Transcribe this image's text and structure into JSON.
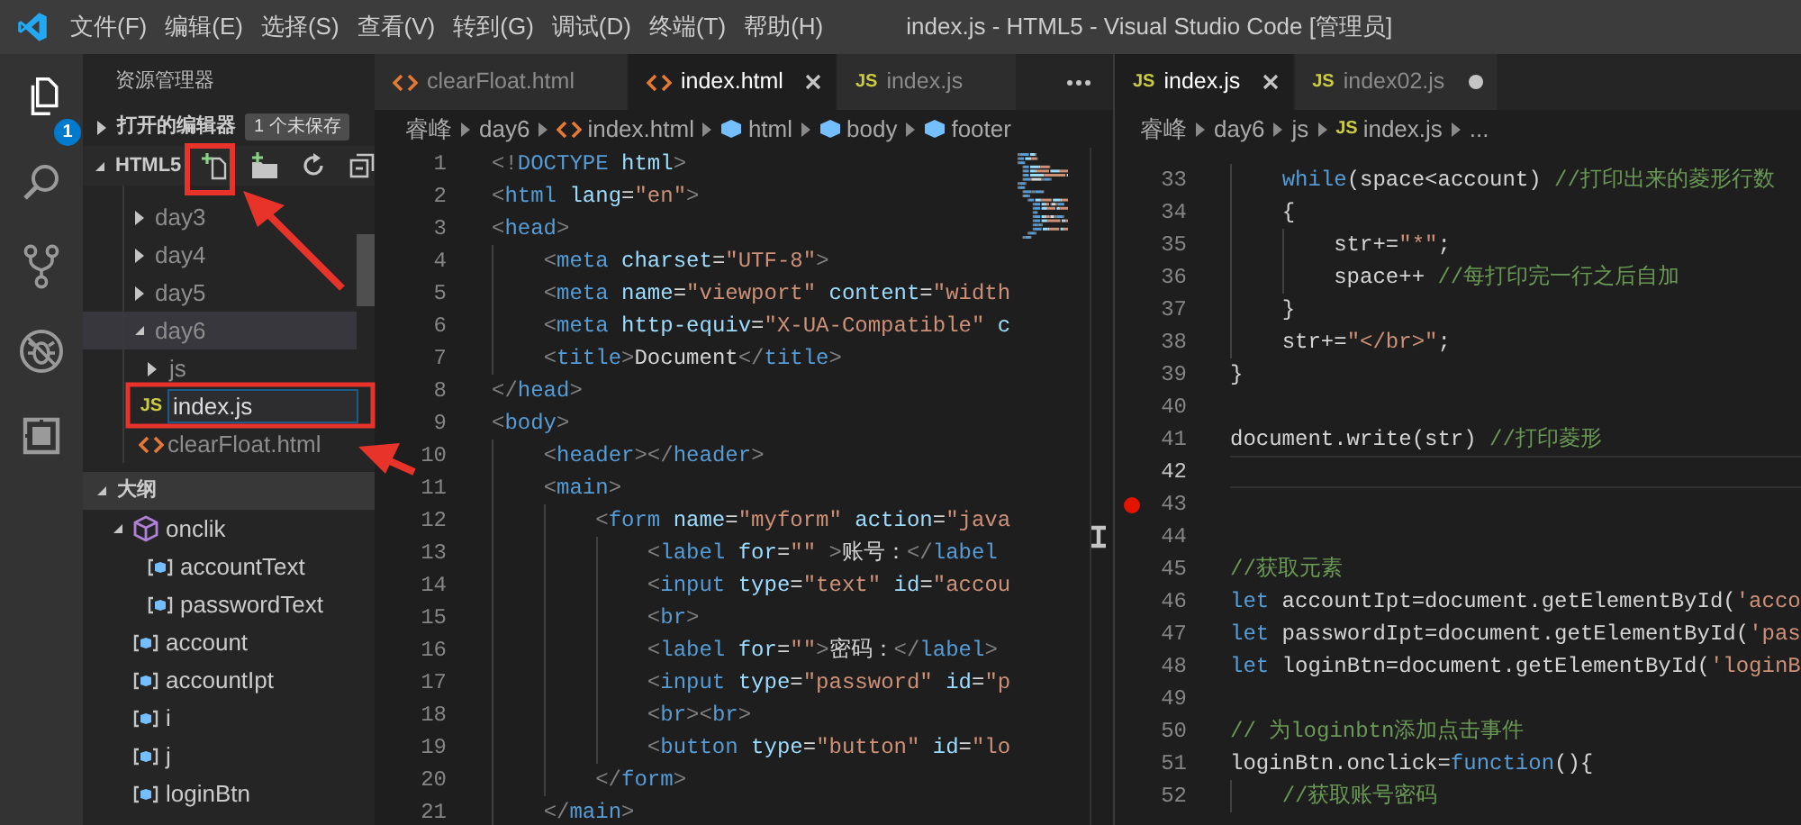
{
  "title_bar": {
    "menu": [
      "文件(F)",
      "编辑(E)",
      "选择(S)",
      "查看(V)",
      "转到(G)",
      "调试(D)",
      "终端(T)",
      "帮助(H)"
    ],
    "title": "index.js - HTML5 - Visual Studio Code [管理员]"
  },
  "activity_bar": [
    {
      "kind": "explorer",
      "selected": true,
      "badge": "1"
    },
    {
      "kind": "search",
      "selected": false
    },
    {
      "kind": "source-control",
      "selected": false
    },
    {
      "kind": "debug",
      "selected": false
    },
    {
      "kind": "extensions",
      "selected": false
    }
  ],
  "sidebar": {
    "title": "资源管理器",
    "open_editors": {
      "label": "打开的编辑器",
      "expanded": false,
      "badge": "1 个未保存"
    },
    "folder": {
      "label": "HTML5",
      "expanded": true
    },
    "tree": [
      {
        "kind": "folder",
        "label": "day3",
        "expanded": false,
        "selected": false
      },
      {
        "kind": "folder",
        "label": "day4",
        "expanded": false,
        "selected": false
      },
      {
        "kind": "folder",
        "label": "day5",
        "expanded": false,
        "selected": false
      },
      {
        "kind": "folder",
        "label": "day6",
        "expanded": true,
        "selected": true,
        "children": [
          {
            "kind": "folder",
            "label": "js",
            "expanded": false,
            "selected": false
          },
          {
            "kind": "new-file",
            "icon": "JS",
            "value": "index.js",
            "selected": false
          },
          {
            "kind": "html",
            "label": "clearFloat.html",
            "selected": false
          }
        ]
      }
    ],
    "outline": {
      "label": "大纲",
      "expanded": true,
      "items": [
        {
          "kind": "module",
          "label": "onclik",
          "expanded": true,
          "children": [
            {
              "kind": "variable",
              "label": "accountText"
            },
            {
              "kind": "variable",
              "label": "passwordText"
            }
          ]
        },
        {
          "kind": "variable",
          "label": "account"
        },
        {
          "kind": "variable",
          "label": "accountIpt"
        },
        {
          "kind": "variable",
          "label": "i"
        },
        {
          "kind": "variable",
          "label": "j"
        },
        {
          "kind": "variable",
          "label": "loginBtn"
        }
      ]
    }
  },
  "editors": [
    {
      "tabs": [
        {
          "kind": "html",
          "label": "clearFloat.html",
          "selected": false,
          "dirty": false
        },
        {
          "kind": "html",
          "label": "index.html",
          "selected": true,
          "dirty": false
        },
        {
          "kind": "js",
          "icon": "JS",
          "label": "index.js",
          "selected": false,
          "dirty": false
        }
      ],
      "breadcrumb": [
        {
          "kind": "folder",
          "label": "睿峰"
        },
        {
          "kind": "folder",
          "label": "day6"
        },
        {
          "kind": "html",
          "label": "index.html"
        },
        {
          "kind": "symbol",
          "label": "html"
        },
        {
          "kind": "symbol",
          "label": "body"
        },
        {
          "kind": "symbol",
          "label": "footer"
        }
      ],
      "lines": [
        {
          "n": "1",
          "tokens": [
            {
              "kind": "punct",
              "text": "<!"
            },
            {
              "kind": "tag",
              "text": "DOCTYPE"
            },
            {
              "kind": "attr",
              "text": " html"
            },
            {
              "kind": "punct",
              "text": ">"
            }
          ]
        },
        {
          "n": "2",
          "tokens": [
            {
              "kind": "punct",
              "text": "<"
            },
            {
              "kind": "tag",
              "text": "html"
            },
            {
              "kind": "attr",
              "text": " lang"
            },
            {
              "kind": "text",
              "text": "="
            },
            {
              "kind": "string",
              "text": "\"en\""
            },
            {
              "kind": "punct",
              "text": ">"
            }
          ]
        },
        {
          "n": "3",
          "tokens": [
            {
              "kind": "punct",
              "text": "<"
            },
            {
              "kind": "tag",
              "text": "head"
            },
            {
              "kind": "punct",
              "text": ">"
            }
          ]
        },
        {
          "n": "4",
          "tokens": [
            {
              "kind": "punct",
              "text": "    <"
            },
            {
              "kind": "tag",
              "text": "meta"
            },
            {
              "kind": "attr",
              "text": " charset"
            },
            {
              "kind": "text",
              "text": "="
            },
            {
              "kind": "string",
              "text": "\"UTF-8\""
            },
            {
              "kind": "punct",
              "text": ">"
            }
          ]
        },
        {
          "n": "5",
          "tokens": [
            {
              "kind": "punct",
              "text": "    <"
            },
            {
              "kind": "tag",
              "text": "meta"
            },
            {
              "kind": "attr",
              "text": " name"
            },
            {
              "kind": "text",
              "text": "="
            },
            {
              "kind": "string",
              "text": "\"viewport\""
            },
            {
              "kind": "attr",
              "text": " content"
            },
            {
              "kind": "text",
              "text": "="
            },
            {
              "kind": "string",
              "text": "\"width"
            }
          ]
        },
        {
          "n": "6",
          "tokens": [
            {
              "kind": "punct",
              "text": "    <"
            },
            {
              "kind": "tag",
              "text": "meta"
            },
            {
              "kind": "attr",
              "text": " http-equiv"
            },
            {
              "kind": "text",
              "text": "="
            },
            {
              "kind": "string",
              "text": "\"X-UA-Compatible\""
            },
            {
              "kind": "attr",
              "text": " c"
            }
          ]
        },
        {
          "n": "7",
          "tokens": [
            {
              "kind": "punct",
              "text": "    <"
            },
            {
              "kind": "tag",
              "text": "title"
            },
            {
              "kind": "punct",
              "text": ">"
            },
            {
              "kind": "text",
              "text": "Document"
            },
            {
              "kind": "punct",
              "text": "</"
            },
            {
              "kind": "tag",
              "text": "title"
            },
            {
              "kind": "punct",
              "text": ">"
            }
          ]
        },
        {
          "n": "8",
          "tokens": [
            {
              "kind": "punct",
              "text": "</"
            },
            {
              "kind": "tag",
              "text": "head"
            },
            {
              "kind": "punct",
              "text": ">"
            }
          ]
        },
        {
          "n": "9",
          "tokens": [
            {
              "kind": "punct",
              "text": "<"
            },
            {
              "kind": "tag",
              "text": "body"
            },
            {
              "kind": "punct",
              "text": ">"
            }
          ]
        },
        {
          "n": "10",
          "tokens": [
            {
              "kind": "punct",
              "text": "    <"
            },
            {
              "kind": "tag",
              "text": "header"
            },
            {
              "kind": "punct",
              "text": "></"
            },
            {
              "kind": "tag",
              "text": "header"
            },
            {
              "kind": "punct",
              "text": ">"
            }
          ]
        },
        {
          "n": "11",
          "tokens": [
            {
              "kind": "punct",
              "text": "    <"
            },
            {
              "kind": "tag",
              "text": "main"
            },
            {
              "kind": "punct",
              "text": ">"
            }
          ]
        },
        {
          "n": "12",
          "tokens": [
            {
              "kind": "punct",
              "text": "        <"
            },
            {
              "kind": "tag",
              "text": "form"
            },
            {
              "kind": "attr",
              "text": " name"
            },
            {
              "kind": "text",
              "text": "="
            },
            {
              "kind": "string",
              "text": "\"myform\""
            },
            {
              "kind": "attr",
              "text": " action"
            },
            {
              "kind": "text",
              "text": "="
            },
            {
              "kind": "string",
              "text": "\"java"
            }
          ]
        },
        {
          "n": "13",
          "tokens": [
            {
              "kind": "punct",
              "text": "            <"
            },
            {
              "kind": "tag",
              "text": "label"
            },
            {
              "kind": "attr",
              "text": " for"
            },
            {
              "kind": "text",
              "text": "="
            },
            {
              "kind": "string",
              "text": "\"\""
            },
            {
              "kind": "punct",
              "text": " >"
            },
            {
              "kind": "text",
              "text": "账号："
            },
            {
              "kind": "punct",
              "text": "</"
            },
            {
              "kind": "tag",
              "text": "label"
            }
          ]
        },
        {
          "n": "14",
          "tokens": [
            {
              "kind": "punct",
              "text": "            <"
            },
            {
              "kind": "tag",
              "text": "input"
            },
            {
              "kind": "attr",
              "text": " type"
            },
            {
              "kind": "text",
              "text": "="
            },
            {
              "kind": "string",
              "text": "\"text\""
            },
            {
              "kind": "attr",
              "text": " id"
            },
            {
              "kind": "text",
              "text": "="
            },
            {
              "kind": "string",
              "text": "\"accou"
            }
          ]
        },
        {
          "n": "15",
          "tokens": [
            {
              "kind": "punct",
              "text": "            <"
            },
            {
              "kind": "tag",
              "text": "br"
            },
            {
              "kind": "punct",
              "text": ">"
            }
          ]
        },
        {
          "n": "16",
          "tokens": [
            {
              "kind": "punct",
              "text": "            <"
            },
            {
              "kind": "tag",
              "text": "label"
            },
            {
              "kind": "attr",
              "text": " for"
            },
            {
              "kind": "text",
              "text": "="
            },
            {
              "kind": "string",
              "text": "\"\""
            },
            {
              "kind": "punct",
              "text": ">"
            },
            {
              "kind": "text",
              "text": "密码："
            },
            {
              "kind": "punct",
              "text": "</"
            },
            {
              "kind": "tag",
              "text": "label"
            },
            {
              "kind": "punct",
              "text": ">"
            }
          ]
        },
        {
          "n": "17",
          "tokens": [
            {
              "kind": "punct",
              "text": "            <"
            },
            {
              "kind": "tag",
              "text": "input"
            },
            {
              "kind": "attr",
              "text": " type"
            },
            {
              "kind": "text",
              "text": "="
            },
            {
              "kind": "string",
              "text": "\"password\""
            },
            {
              "kind": "attr",
              "text": " id"
            },
            {
              "kind": "text",
              "text": "="
            },
            {
              "kind": "string",
              "text": "\"p"
            }
          ]
        },
        {
          "n": "18",
          "tokens": [
            {
              "kind": "punct",
              "text": "            <"
            },
            {
              "kind": "tag",
              "text": "br"
            },
            {
              "kind": "punct",
              "text": "><"
            },
            {
              "kind": "tag",
              "text": "br"
            },
            {
              "kind": "punct",
              "text": ">"
            }
          ]
        },
        {
          "n": "19",
          "tokens": [
            {
              "kind": "punct",
              "text": "            <"
            },
            {
              "kind": "tag",
              "text": "button"
            },
            {
              "kind": "attr",
              "text": " type"
            },
            {
              "kind": "text",
              "text": "="
            },
            {
              "kind": "string",
              "text": "\"button\""
            },
            {
              "kind": "attr",
              "text": " id"
            },
            {
              "kind": "text",
              "text": "="
            },
            {
              "kind": "string",
              "text": "\"lo"
            }
          ]
        },
        {
          "n": "20",
          "tokens": [
            {
              "kind": "punct",
              "text": "        </"
            },
            {
              "kind": "tag",
              "text": "form"
            },
            {
              "kind": "punct",
              "text": ">"
            }
          ]
        },
        {
          "n": "21",
          "tokens": [
            {
              "kind": "punct",
              "text": "    </"
            },
            {
              "kind": "tag",
              "text": "main"
            },
            {
              "kind": "punct",
              "text": ">"
            }
          ]
        }
      ]
    },
    {
      "tabs": [
        {
          "kind": "js",
          "icon": "JS",
          "label": "index.js",
          "selected": true,
          "dirty": false
        },
        {
          "kind": "js",
          "icon": "JS",
          "label": "index02.js",
          "selected": false,
          "dirty": true
        }
      ],
      "breadcrumb": [
        {
          "kind": "folder",
          "label": "睿峰"
        },
        {
          "kind": "folder",
          "label": "day6"
        },
        {
          "kind": "folder",
          "label": "js"
        },
        {
          "kind": "js",
          "icon": "JS",
          "label": "index.js"
        },
        {
          "kind": "more",
          "label": "..."
        }
      ],
      "lines": [
        {
          "n": "33",
          "current": false,
          "breakpoint": false,
          "tokens": [
            {
              "kind": "keyword",
              "text": "    while"
            },
            {
              "kind": "text",
              "text": "(space<account) "
            },
            {
              "kind": "comment",
              "text": "//打印出来的菱形行数"
            }
          ]
        },
        {
          "n": "34",
          "current": false,
          "breakpoint": false,
          "tokens": [
            {
              "kind": "text",
              "text": "    {"
            }
          ]
        },
        {
          "n": "35",
          "current": false,
          "breakpoint": false,
          "tokens": [
            {
              "kind": "text",
              "text": "        str+="
            },
            {
              "kind": "string",
              "text": "\"*\""
            },
            {
              "kind": "text",
              "text": ";"
            }
          ]
        },
        {
          "n": "36",
          "current": false,
          "breakpoint": false,
          "tokens": [
            {
              "kind": "text",
              "text": "        space++ "
            },
            {
              "kind": "comment",
              "text": "//每打印完一行之后自加"
            }
          ]
        },
        {
          "n": "37",
          "current": false,
          "breakpoint": false,
          "tokens": [
            {
              "kind": "text",
              "text": "    }"
            }
          ]
        },
        {
          "n": "38",
          "current": false,
          "breakpoint": false,
          "tokens": [
            {
              "kind": "text",
              "text": "    str+="
            },
            {
              "kind": "string",
              "text": "\"</br>\""
            },
            {
              "kind": "text",
              "text": ";"
            }
          ]
        },
        {
          "n": "39",
          "current": false,
          "breakpoint": false,
          "tokens": [
            {
              "kind": "text",
              "text": "}"
            }
          ]
        },
        {
          "n": "40",
          "current": false,
          "breakpoint": false
        },
        {
          "n": "41",
          "current": false,
          "breakpoint": false,
          "tokens": [
            {
              "kind": "text",
              "text": "document.write(str) "
            },
            {
              "kind": "comment",
              "text": "//打印菱形"
            }
          ]
        },
        {
          "n": "42",
          "current": true,
          "breakpoint": false
        },
        {
          "n": "43",
          "current": false,
          "breakpoint": true
        },
        {
          "n": "44",
          "current": false,
          "breakpoint": false
        },
        {
          "n": "45",
          "current": false,
          "breakpoint": false,
          "tokens": [
            {
              "kind": "comment",
              "text": "//获取元素"
            }
          ]
        },
        {
          "n": "46",
          "current": false,
          "breakpoint": false,
          "tokens": [
            {
              "kind": "keyword",
              "text": "let"
            },
            {
              "kind": "text",
              "text": " accountIpt=document.getElementById("
            },
            {
              "kind": "string",
              "text": "'acco"
            }
          ]
        },
        {
          "n": "47",
          "current": false,
          "breakpoint": false,
          "tokens": [
            {
              "kind": "keyword",
              "text": "let"
            },
            {
              "kind": "text",
              "text": " passwordIpt=document.getElementById("
            },
            {
              "kind": "string",
              "text": "'pas"
            }
          ]
        },
        {
          "n": "48",
          "current": false,
          "breakpoint": false,
          "tokens": [
            {
              "kind": "keyword",
              "text": "let"
            },
            {
              "kind": "text",
              "text": " loginBtn=document.getElementById("
            },
            {
              "kind": "string",
              "text": "'loginB"
            }
          ]
        },
        {
          "n": "49",
          "current": false,
          "breakpoint": false
        },
        {
          "n": "50",
          "current": false,
          "breakpoint": false,
          "tokens": [
            {
              "kind": "comment",
              "text": "// 为loginbtn添加点击事件"
            }
          ]
        },
        {
          "n": "51",
          "current": false,
          "breakpoint": false,
          "tokens": [
            {
              "kind": "text",
              "text": "loginBtn.onclick="
            },
            {
              "kind": "keyword",
              "text": "function"
            },
            {
              "kind": "text",
              "text": "(){"
            }
          ]
        },
        {
          "n": "52",
          "current": false,
          "breakpoint": false,
          "tokens": [
            {
              "kind": "comment",
              "text": "    //获取账号密码"
            }
          ]
        }
      ]
    }
  ]
}
